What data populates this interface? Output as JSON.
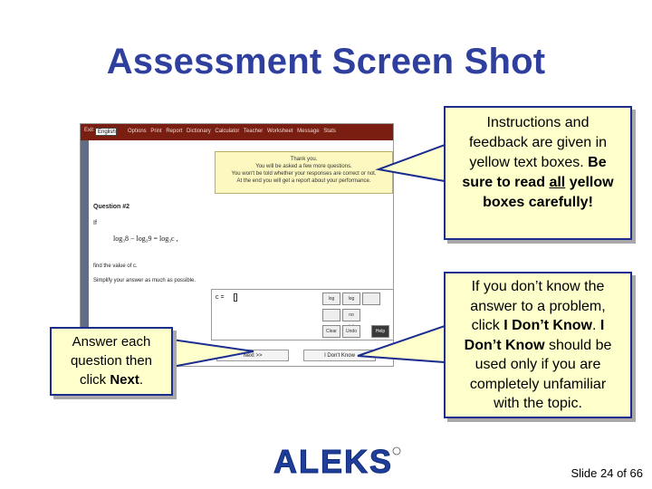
{
  "title": "Assessment Screen Shot",
  "screenshot": {
    "lang_label": "Exit",
    "language": "English",
    "menu": "Options Print Report Dictionary Calculator Teacher Worksheet Message Stats",
    "notice": {
      "line1": "Thank you.",
      "line2": "You will be asked a few more questions.",
      "line3": "You won't be told whether your responses are correct or not.",
      "line4": "At the end you will get a report about your performance."
    },
    "question_title": "Question #2",
    "if_label": "If",
    "equation": "log₃8 − log₃9 = log₃c ,",
    "find_text": "find the value of c.",
    "simplify_text": "Simplify your answer as much as possible.",
    "answer_prefix": "c =",
    "tools": {
      "log": "log",
      "logbase": "log",
      "box": "",
      "frac": "",
      "nosol": "no solution",
      "clear": "Clear",
      "undo": "Undo",
      "help": "Help"
    },
    "next_label": "Next >>",
    "idk_label": "I Don't Know"
  },
  "callouts": {
    "top": {
      "line1": "Instructions and",
      "line2": "feedback are given in",
      "line3": "yellow text boxes.",
      "line3_bold": "Be",
      "line4_a": "sure to read",
      "line4_u": "all",
      "line4_b": "yellow",
      "line5": "boxes carefully!"
    },
    "left": {
      "line1": "Answer each",
      "line2": "question then",
      "line3_a": "click",
      "line3_b": "Next",
      "line3_c": "."
    },
    "right": {
      "line1": "If you don’t know the",
      "line2": "answer to a problem,",
      "line3_a": "click",
      "line3_b": "I Don’t Know",
      "line3_c": ".",
      "line3_d": "I",
      "line4_a": "Don’t Know",
      "line4_b": "should be",
      "line5": "used only if you are",
      "line6": "completely unfamiliar",
      "line7": "with the topic."
    }
  },
  "logo_text": "ALEKS",
  "slide_number": "Slide 24 of 66",
  "colors": {
    "title": "#2f3f9e",
    "callout_fill": "#ffffcc",
    "callout_border": "#1b2d8f",
    "logo_blue": "#1f3f9a",
    "topbar": "#7a1e12"
  }
}
